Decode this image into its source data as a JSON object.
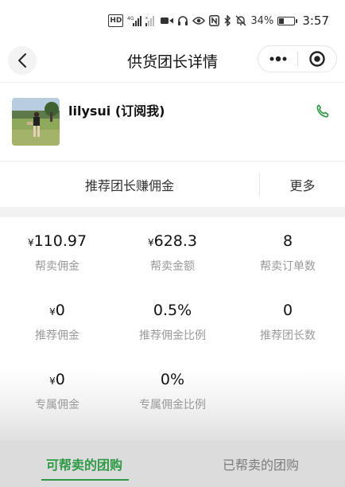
{
  "status_bar": {
    "hd_badge": "HD",
    "network_label": "4G",
    "battery_percent": "34%",
    "battery_level": 0.34,
    "time": "3:57",
    "icons": [
      "hd-icon",
      "signal-icon",
      "signal-weak-icon",
      "video-icon",
      "headset-icon",
      "eye-icon",
      "nfc-icon",
      "bluetooth-icon",
      "mute-icon",
      "battery-icon"
    ]
  },
  "nav": {
    "title": "供货团长详情",
    "back_icon": "chevron-left-icon",
    "more_icon": "more-dots-icon",
    "close_icon": "target-close-icon"
  },
  "profile": {
    "name": "lilysui (订阅我)",
    "phone_icon": "phone-icon"
  },
  "actions": {
    "recommend_label": "推荐团长赚佣金",
    "more_label": "更多"
  },
  "stats": [
    {
      "value": "110.97",
      "currency": "¥",
      "label": "帮卖佣金"
    },
    {
      "value": "628.3",
      "currency": "¥",
      "label": "帮卖金额"
    },
    {
      "value": "8",
      "currency": "",
      "label": "帮卖订单数"
    },
    {
      "value": "0",
      "currency": "¥",
      "label": "推荐佣金"
    },
    {
      "value": "0.5%",
      "currency": "",
      "label": "推荐佣金比例"
    },
    {
      "value": "0",
      "currency": "",
      "label": "推荐团长数"
    },
    {
      "value": "0",
      "currency": "¥",
      "label": "专属佣金"
    },
    {
      "value": "0%",
      "currency": "",
      "label": "专属佣金比例"
    }
  ],
  "tabs": {
    "active_label": "可帮卖的团购",
    "inactive_label": "已帮卖的团购"
  },
  "colors": {
    "accent_green": "#2e9a45",
    "label_gray": "#9a9a9a"
  }
}
